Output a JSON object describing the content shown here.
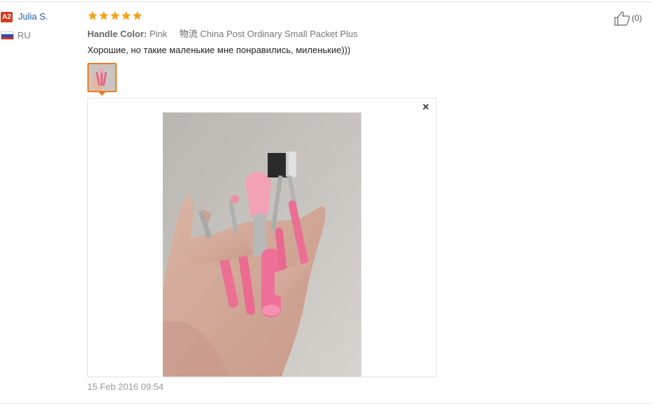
{
  "user": {
    "level_badge": "A2",
    "name": "Julia S.",
    "country": "RU",
    "flag_colors": [
      "#ffffff",
      "#1f4fbf",
      "#d62718"
    ]
  },
  "feedback": {
    "stars": 5,
    "star_color": "#f7a21b",
    "attribute_label": "Handle Color:",
    "attribute_value": "Pink",
    "shipping_label": "物流",
    "shipping_value": "China Post Ordinary Small Packet Plus",
    "text": "Хорошие, но такие маленькие мне понравились, миленькие)))",
    "date": "15 Feb 2016 09:54",
    "accent_color": "#f27b22"
  },
  "viewer": {
    "close_label": "×"
  },
  "helpful": {
    "count": "(0)"
  },
  "icons": {
    "badge": "level-badge",
    "flag": "russia-flag-icon",
    "star": "star-icon",
    "like": "thumbs-up-icon",
    "close": "close-icon"
  }
}
